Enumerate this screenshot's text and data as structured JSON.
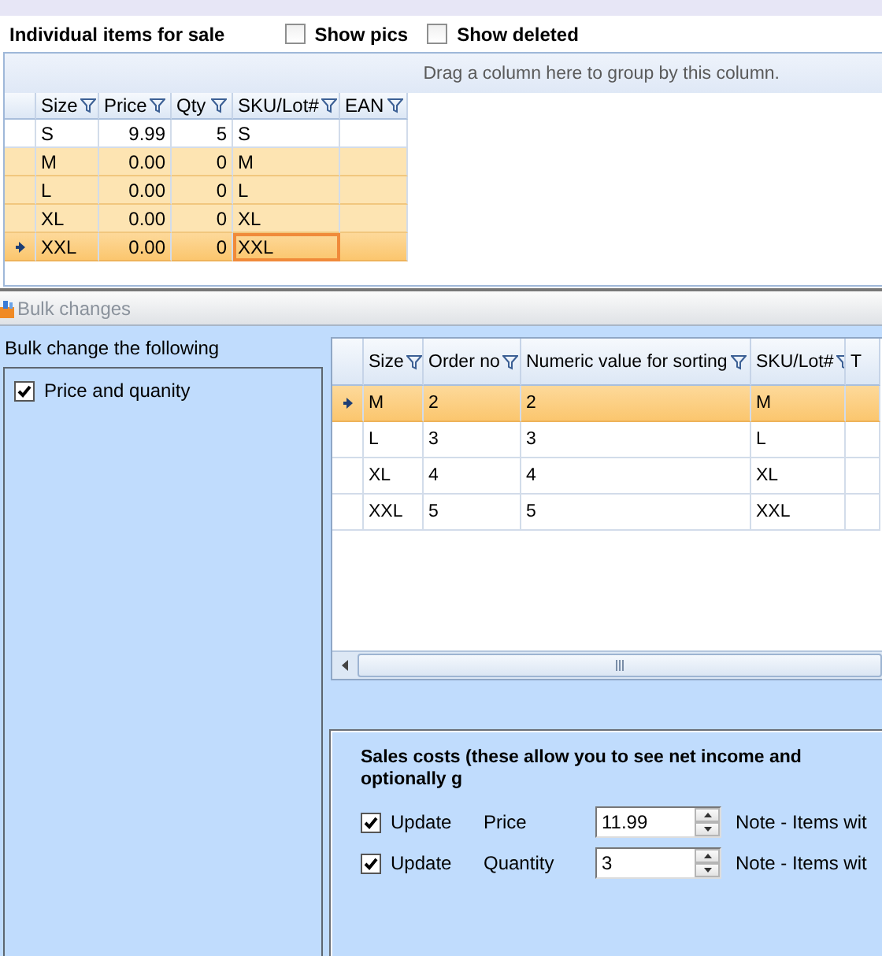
{
  "header": {
    "title": "Individual items for sale",
    "options": [
      {
        "label": "Show pics",
        "checked": false
      },
      {
        "label": "Show deleted",
        "checked": false
      }
    ]
  },
  "items_grid": {
    "group_hint": "Drag a column here to group by this column.",
    "columns": [
      {
        "label": "Size",
        "kind": "text",
        "filter_icon": true
      },
      {
        "label": "Price",
        "kind": "number",
        "filter_icon": true
      },
      {
        "label": "Qty",
        "kind": "number",
        "filter_icon": true
      },
      {
        "label": "SKU/Lot#",
        "kind": "text",
        "filter_icon": true
      },
      {
        "label": "EAN",
        "kind": "text",
        "filter_icon": true
      }
    ],
    "rows": [
      {
        "selected": false,
        "current": false,
        "cells": [
          {
            "text": "S",
            "focused": false
          },
          {
            "text": "9.99",
            "focused": false
          },
          {
            "text": "5",
            "focused": false
          },
          {
            "text": "S",
            "focused": false
          },
          {
            "focused": false
          }
        ]
      },
      {
        "selected": true,
        "current": false,
        "cells": [
          {
            "text": "M",
            "focused": false
          },
          {
            "text": "0.00",
            "focused": false
          },
          {
            "text": "0",
            "focused": false
          },
          {
            "text": "M",
            "focused": false
          },
          {
            "focused": false
          }
        ]
      },
      {
        "selected": true,
        "current": false,
        "cells": [
          {
            "text": "L",
            "focused": false
          },
          {
            "text": "0.00",
            "focused": false
          },
          {
            "text": "0",
            "focused": false
          },
          {
            "text": "L",
            "focused": false
          },
          {
            "focused": false
          }
        ]
      },
      {
        "selected": true,
        "current": false,
        "cells": [
          {
            "text": "XL",
            "focused": false
          },
          {
            "text": "0.00",
            "focused": false
          },
          {
            "text": "0",
            "focused": false
          },
          {
            "text": "XL",
            "focused": false
          },
          {
            "focused": false
          }
        ]
      },
      {
        "selected": true,
        "current": true,
        "cells": [
          {
            "text": "XXL",
            "focused": false
          },
          {
            "text": "0.00",
            "focused": false
          },
          {
            "text": "0",
            "focused": false
          },
          {
            "text": "XXL",
            "focused": true
          },
          {
            "focused": false
          }
        ]
      }
    ]
  },
  "bulk_changes": {
    "title": "Bulk changes",
    "section_label": "Bulk change the following",
    "options": [
      {
        "label": "Price and quanity",
        "checked": true
      }
    ],
    "sizes_grid": {
      "columns": [
        {
          "label": "Size",
          "kind": "text",
          "filter_icon": true
        },
        {
          "label": "Order no",
          "kind": "text",
          "filter_icon": true
        },
        {
          "label": "Numeric value for sorting",
          "kind": "text",
          "filter_icon": true
        },
        {
          "label": "SKU/Lot#",
          "kind": "text",
          "filter_icon": true
        },
        {
          "label": "T",
          "kind": "text",
          "filter_icon": false
        }
      ],
      "rows": [
        {
          "selected": true,
          "current": true,
          "cells": [
            {
              "text": "M",
              "focused": false
            },
            {
              "text": "2",
              "focused": false
            },
            {
              "text": "2",
              "focused": false
            },
            {
              "text": "M",
              "focused": false
            },
            {
              "focused": false
            }
          ]
        },
        {
          "selected": false,
          "current": false,
          "cells": [
            {
              "text": "L",
              "focused": false
            },
            {
              "text": "3",
              "focused": false
            },
            {
              "text": "3",
              "focused": false
            },
            {
              "text": "L",
              "focused": false
            },
            {
              "focused": false
            }
          ]
        },
        {
          "selected": false,
          "current": false,
          "cells": [
            {
              "text": "XL",
              "focused": false
            },
            {
              "text": "4",
              "focused": false
            },
            {
              "text": "4",
              "focused": false
            },
            {
              "text": "XL",
              "focused": false
            },
            {
              "focused": false
            }
          ]
        },
        {
          "selected": false,
          "current": false,
          "cells": [
            {
              "text": "XXL",
              "focused": false
            },
            {
              "text": "5",
              "focused": false
            },
            {
              "text": "5",
              "focused": false
            },
            {
              "text": "XXL",
              "focused": false
            },
            {
              "focused": false
            }
          ]
        }
      ]
    },
    "sales_costs": {
      "title": "Sales costs (these allow you to see net income and optionally g",
      "rows": [
        {
          "update_label": "Update",
          "checked": true,
          "label": "Price",
          "value": "11.99",
          "note": "Note - Items wit"
        },
        {
          "update_label": "Update",
          "checked": true,
          "label": "Quantity",
          "value": "3",
          "note": "Note - Items wit"
        }
      ]
    }
  }
}
